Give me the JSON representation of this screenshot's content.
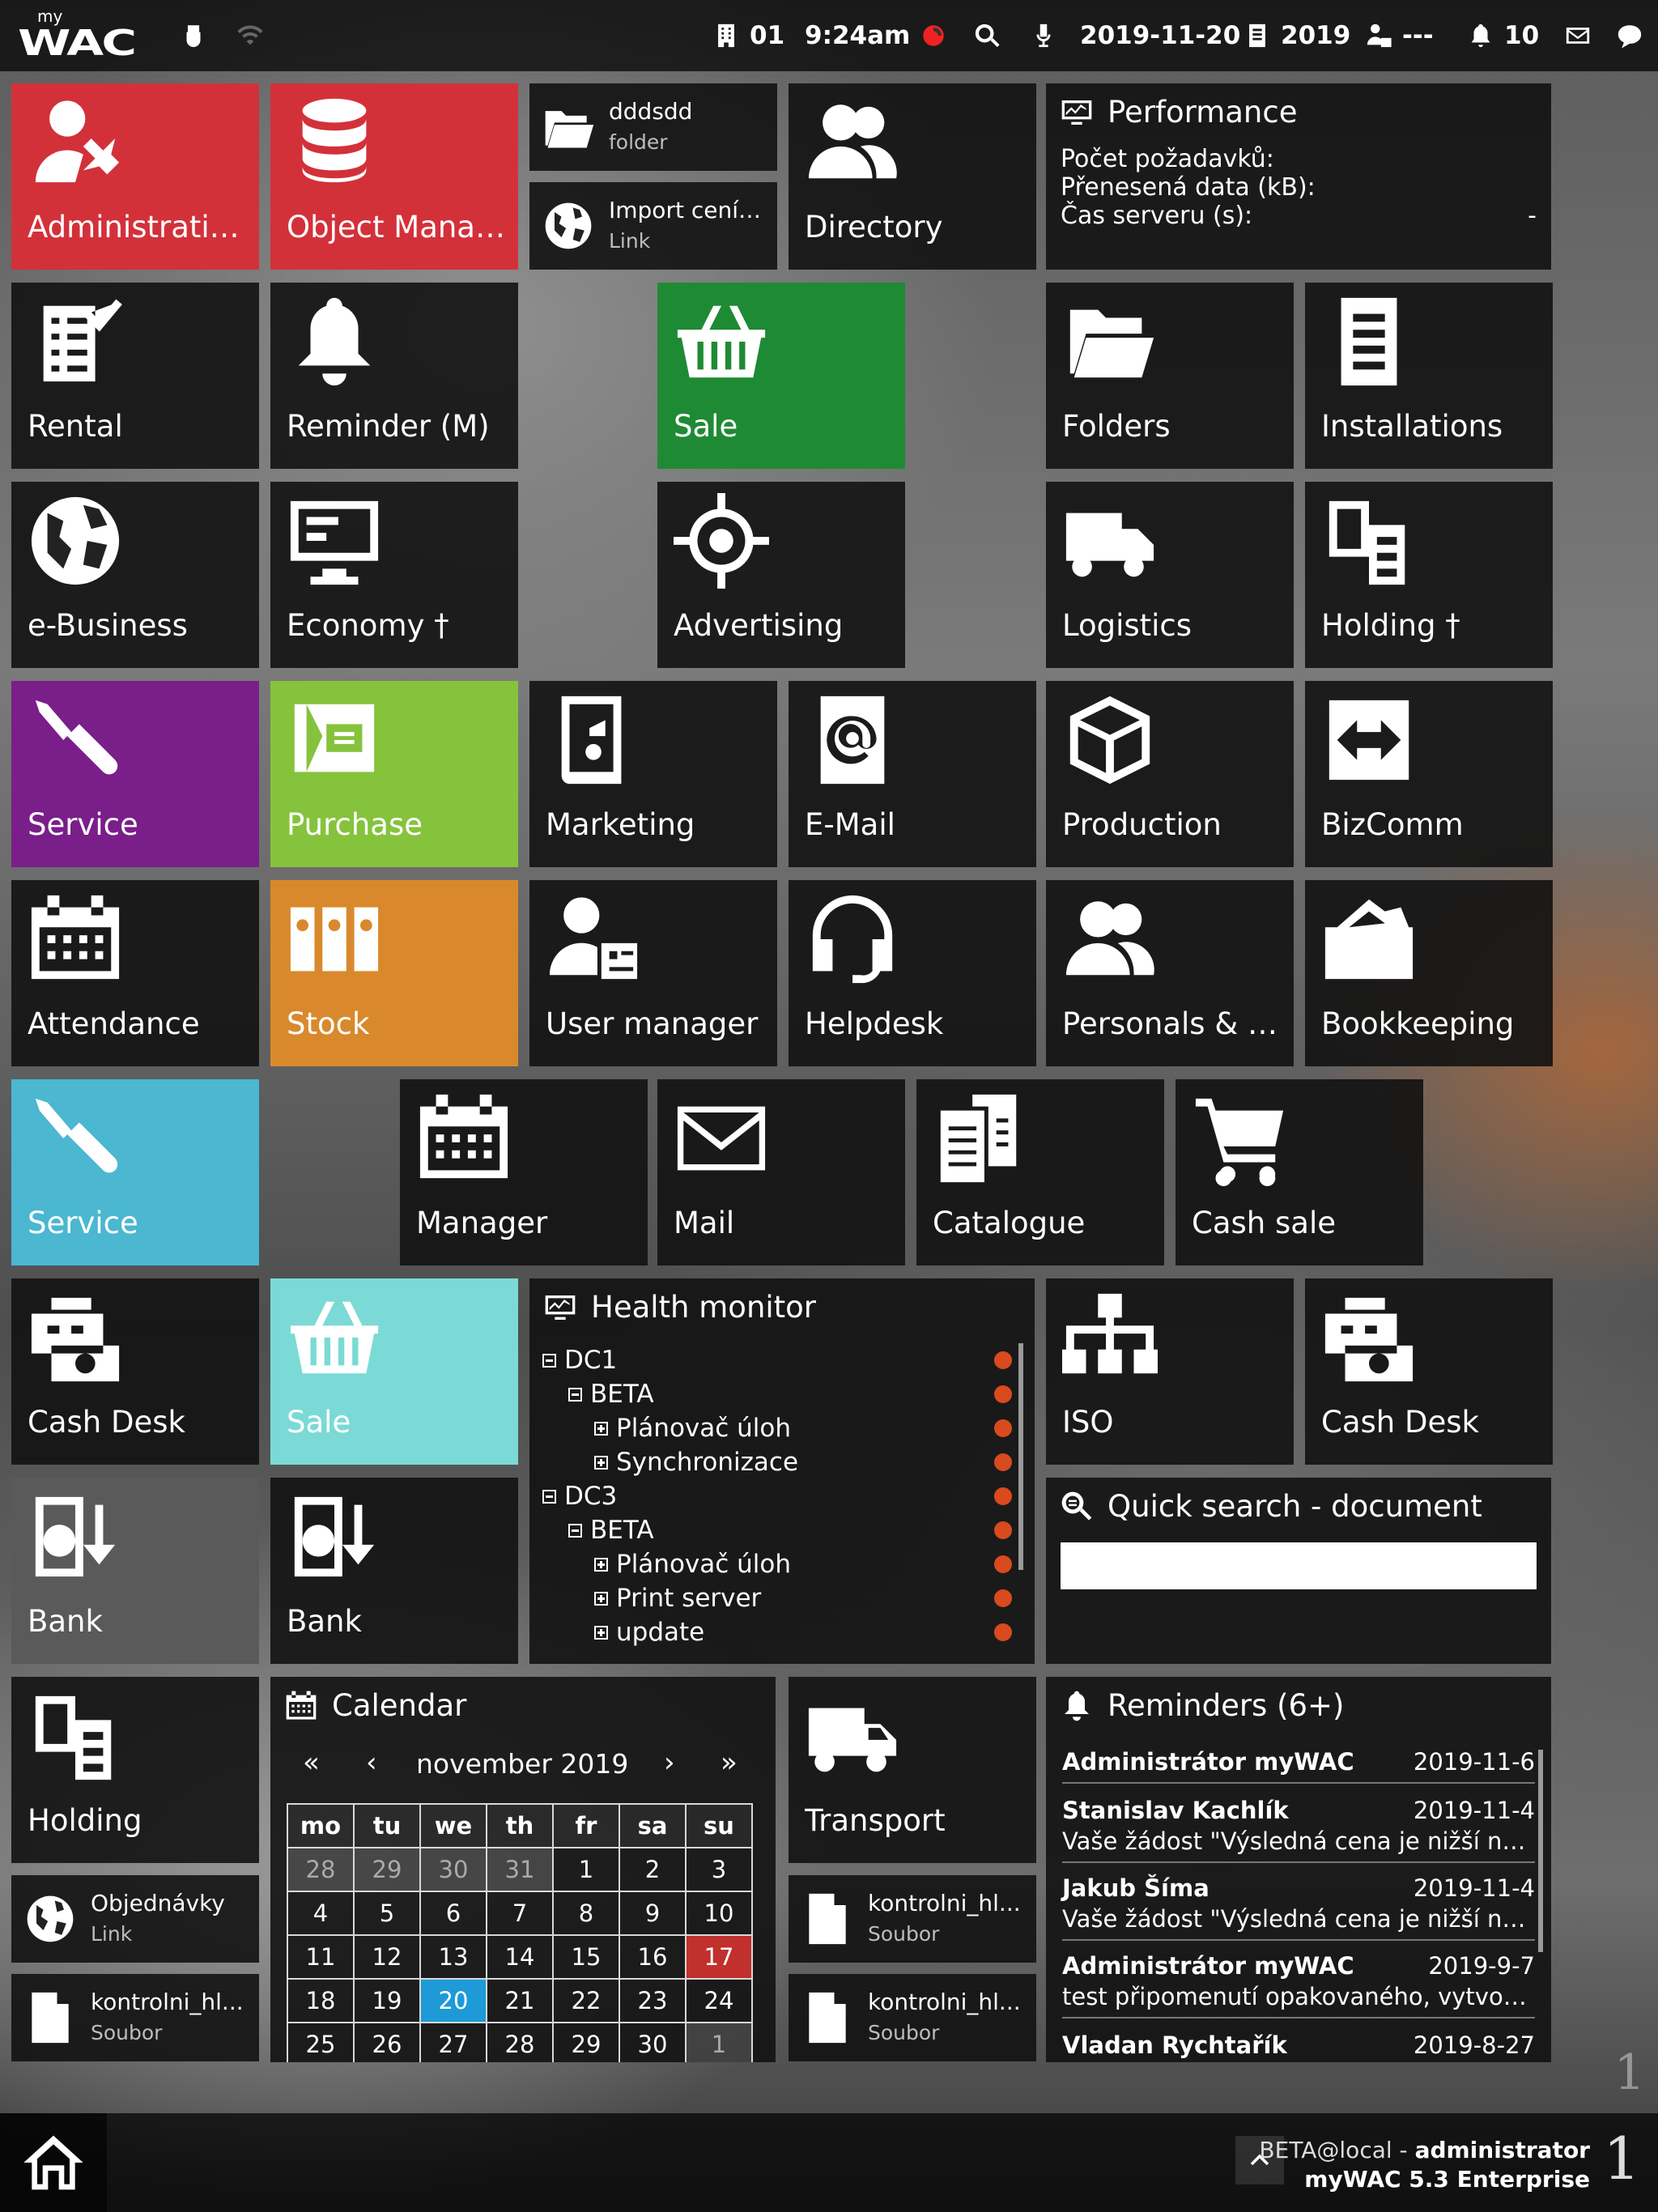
{
  "topbar": {
    "logo_small": "my",
    "logo_main": "WAC",
    "building": "01",
    "time": "9:24am",
    "date": "2019-11-20",
    "year": "2019",
    "user_status": "---",
    "notifications": "10"
  },
  "tiles": {
    "administration": "Administrativ...",
    "object_manager": "Object Manager",
    "directory": "Directory",
    "rental": "Rental",
    "reminder": "Reminder (M)",
    "sale_green": "Sale",
    "folders": "Folders",
    "installations": "Installations",
    "ebusiness": "e-Business",
    "economy": "Economy †",
    "advertising": "Advertising",
    "logistics": "Logistics",
    "holding_dagger": "Holding †",
    "service_purple": "Service",
    "purchase": "Purchase",
    "marketing": "Marketing",
    "email": "E-Mail",
    "production": "Production",
    "bizcomm": "BizComm",
    "attendance": "Attendance",
    "stock": "Stock",
    "user_manager": "User manager",
    "helpdesk": "Helpdesk",
    "personals": "Personals & W...",
    "bookkeeping": "Bookkeeping",
    "service_teal": "Service",
    "manager": "Manager",
    "mail": "Mail",
    "catalogue": "Catalogue",
    "cash_sale": "Cash sale",
    "cash_desk_1": "Cash Desk",
    "sale_aqua": "Sale",
    "iso": "ISO",
    "cash_desk_2": "Cash Desk",
    "bank_1": "Bank",
    "bank_2": "Bank",
    "holding": "Holding",
    "transport": "Transport"
  },
  "shortcuts": {
    "folder": {
      "title": "dddsdd",
      "type": "folder"
    },
    "import_link": {
      "title": "Import ceník...",
      "type": "Link"
    },
    "orders_link": {
      "title": "Objednávky",
      "type": "Link"
    },
    "file_1": {
      "title": "kontrolni_hl...",
      "type": "Soubor"
    },
    "file_2": {
      "title": "kontrolni_hl...",
      "type": "Soubor"
    },
    "file_3": {
      "title": "kontrolni_hl...",
      "type": "Soubor"
    }
  },
  "performance": {
    "title": "Performance",
    "requests": "Počet požadavků:",
    "transfer": "Přenesená data (kB):",
    "server_time": "Čas serveru (s):",
    "server_time_value": "-"
  },
  "health": {
    "title": "Health monitor",
    "rows": [
      {
        "text": "DC1",
        "level": 0,
        "box": "minus"
      },
      {
        "text": "BETA",
        "level": 1,
        "box": "minus"
      },
      {
        "text": "Plánovač úloh",
        "level": 2,
        "box": "plus"
      },
      {
        "text": "Synchronizace",
        "level": 2,
        "box": "plus"
      },
      {
        "text": "DC3",
        "level": 0,
        "box": "minus"
      },
      {
        "text": "BETA",
        "level": 1,
        "box": "minus"
      },
      {
        "text": "Plánovač úloh",
        "level": 2,
        "box": "plus"
      },
      {
        "text": "Print server",
        "level": 2,
        "box": "plus"
      },
      {
        "text": "update",
        "level": 2,
        "box": "plus"
      }
    ]
  },
  "quick_search": {
    "title": "Quick search - document",
    "value": ""
  },
  "calendar": {
    "title": "Calendar",
    "prev_year": "«",
    "prev_month": "‹",
    "month": "november",
    "year": "2019",
    "next_month": "›",
    "next_year": "»",
    "weekdays": [
      "mo",
      "tu",
      "we",
      "th",
      "fr",
      "sa",
      "su"
    ],
    "weeks": [
      [
        "28",
        "29",
        "30",
        "31",
        "1",
        "2",
        "3"
      ],
      [
        "4",
        "5",
        "6",
        "7",
        "8",
        "9",
        "10"
      ],
      [
        "11",
        "12",
        "13",
        "14",
        "15",
        "16",
        "17"
      ],
      [
        "18",
        "19",
        "20",
        "21",
        "22",
        "23",
        "24"
      ],
      [
        "25",
        "26",
        "27",
        "28",
        "29",
        "30",
        "1"
      ]
    ],
    "today": "20",
    "selected": "17"
  },
  "reminders": {
    "title": "Reminders (6+)",
    "items": [
      {
        "who": "Administrátor myWAC",
        "date": "2019-11-6",
        "msg": ""
      },
      {
        "who": "Stanislav Kachlík",
        "date": "2019-11-4",
        "msg": "Vaše žádost \"Výsledná cena je nižší než c..."
      },
      {
        "who": "Jakub Šíma",
        "date": "2019-11-4",
        "msg": "Vaše žádost \"Výsledná cena je nižší než c..."
      },
      {
        "who": "Administrátor myWAC",
        "date": "2019-9-7",
        "msg": "test připomenutí opakovaného, vytvořen..."
      },
      {
        "who": "Vladan Rychtařík",
        "date": "2019-8-27",
        "msg": ""
      }
    ]
  },
  "bottombar": {
    "session": "BETA@local - ",
    "user": "administrator",
    "version": "myWAC 5.3 Enterprise",
    "page": "1",
    "side_page": "1"
  },
  "colors": {
    "red": "#d3313a",
    "green": "#1f8a34",
    "purple": "#7a1e8a",
    "lime": "#86c33c",
    "orange": "#d9892c",
    "teal": "#4bb7d1",
    "aqua": "#7bdad6",
    "bank_gray": "#5a5a5a"
  }
}
